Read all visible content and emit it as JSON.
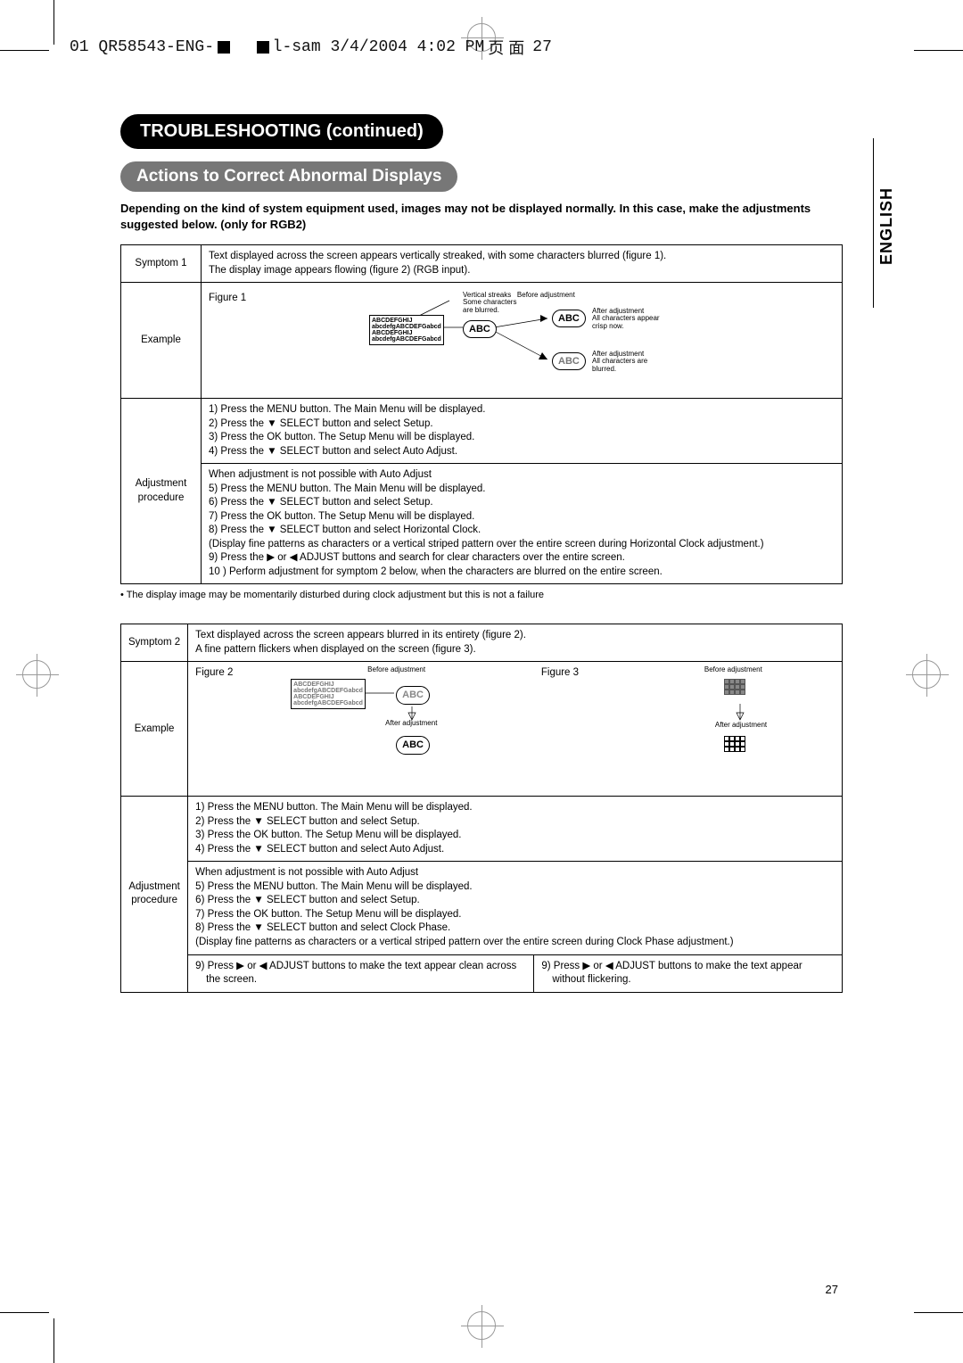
{
  "topbar": {
    "file": "01 QR58543-ENG-",
    "file2": "l-sam  3/4/2004  4:02 PM",
    "page_mark": "27"
  },
  "side": {
    "lang": "ENGLISH"
  },
  "header": {
    "title": "TROUBLESHOOTING (continued)",
    "subtitle": "Actions to Correct Abnormal Displays"
  },
  "intro": "Depending on the kind of system equipment used, images may not be displayed normally.  In this case, make the adjustments suggested below. (only for RGB2)",
  "t1": {
    "symptom_h": "Symptom 1",
    "symptom": "Text displayed across the screen appears vertically streaked, with some characters blurred (figure 1).\nThe display image appears flowing (figure 2) (RGB input).",
    "example_h": "Example",
    "fig1_label": "Figure 1",
    "fig_vert": "Vertical streaks",
    "fig_before": "Before adjustment\nSome characters\nare blurred.",
    "txt_a1": "ABCDEFGHIJ",
    "txt_a2": "abcdefgABCDEFGabcd",
    "abc": "ABC",
    "after1": "After adjustment\nAll characters appear\ncrisp now.",
    "after2": "After adjustment\nAll characters are\nblurred.",
    "adj_h": "Adjustment procedure",
    "proc1": "1) Press the MENU button. The Main Menu will be displayed.\n2) Press the ▼ SELECT button and select Setup.\n3) Press the OK button. The Setup Menu will be displayed.\n4) Press the ▼ SELECT button and select Auto Adjust.",
    "proc2": "When adjustment is not possible with Auto Adjust\n5) Press the MENU button. The Main Menu will be displayed.\n6) Press the ▼ SELECT button and select Setup.\n7) Press the OK button. The Setup Menu will be displayed.\n8) Press the ▼ SELECT button and select Horizontal Clock.\n(Display fine patterns as characters or a vertical striped pattern over the entire screen during Horizontal Clock adjustment.)\n9) Press the ▶ or ◀ ADJUST buttons and search for clear characters over the entire screen.\n10 ) Perform adjustment for symptom 2 below, when the characters are blurred on the entire screen."
  },
  "note1": "• The display image may be momentarily disturbed during clock adjustment but this is not a failure",
  "t2": {
    "symptom_h": "Symptom 2",
    "symptom": "Text displayed across the screen appears blurred in its entirety (figure 2).\nA fine pattern flickers when displayed on the screen (figure 3).",
    "example_h": "Example",
    "fig2_label": "Figure 2",
    "fig3_label": "Figure 3",
    "before": "Before adjustment",
    "after": "After adjustment",
    "adj_h": "Adjustment procedure",
    "proc1": "1) Press the MENU button. The Main Menu will be displayed.\n2) Press the ▼ SELECT button and select Setup.\n3) Press the OK button. The Setup Menu will be displayed.\n4) Press the ▼ SELECT button and select Auto Adjust.",
    "proc2": "When adjustment is not possible with Auto Adjust\n5) Press the MENU button. The Main Menu will be displayed.\n6) Press the ▼ SELECT button and select Setup.\n7) Press the OK button. The Setup Menu will be displayed.\n8) Press the ▼ SELECT button and select Clock Phase.\n(Display fine patterns as characters or a vertical striped pattern over the entire screen during Clock Phase adjustment.)",
    "proc3a": "9) Press ▶ or ◀ ADJUST buttons to make the text appear clean across the screen.",
    "proc3b": "9) Press ▶ or ◀ ADJUST buttons to make the text appear without flickering."
  },
  "page_number": "27"
}
